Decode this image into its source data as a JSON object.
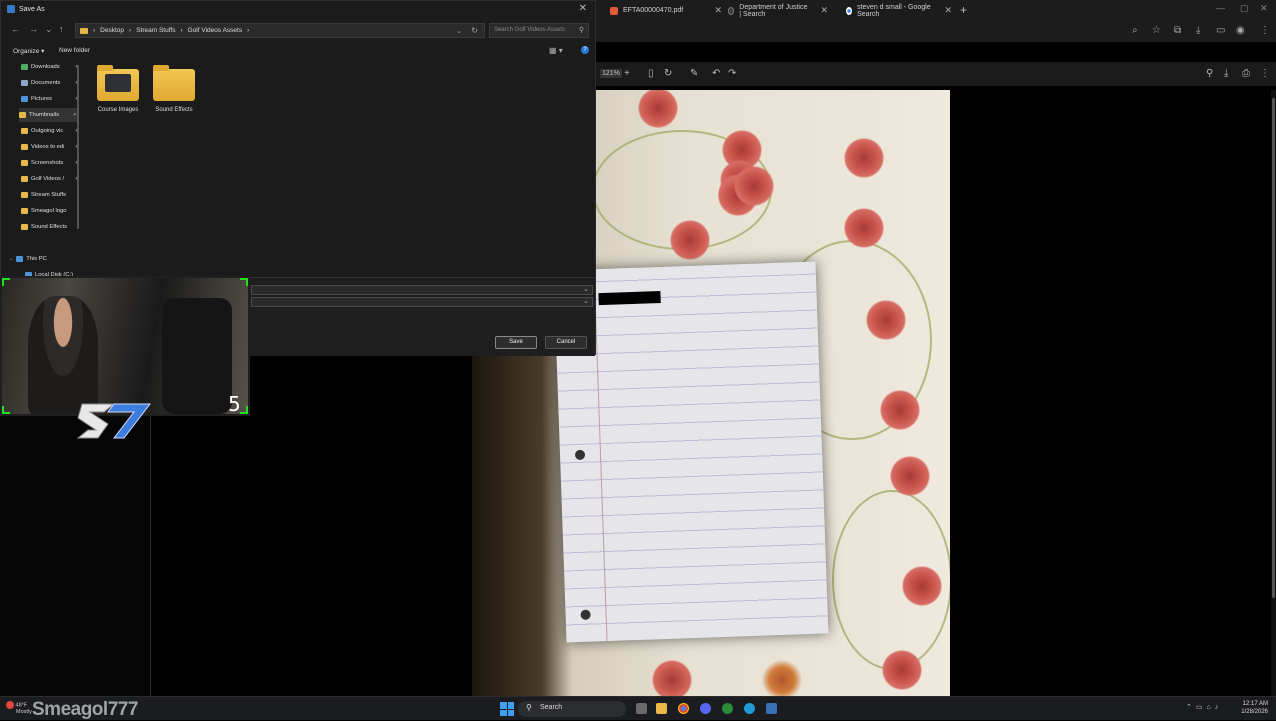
{
  "dialog": {
    "title": "Save As",
    "breadcrumb": [
      "Desktop",
      "Stream Stuffs",
      "Golf Videos Assets"
    ],
    "search_placeholder": "Search Golf Videos Assets",
    "organize_label": "Organize",
    "new_folder_label": "New folder",
    "nav_items": [
      {
        "label": "Downloads",
        "icon": "download-folder-icon",
        "pinned": true
      },
      {
        "label": "Documents",
        "icon": "documents-folder-icon",
        "pinned": true
      },
      {
        "label": "Pictures",
        "icon": "pictures-folder-icon",
        "pinned": true
      },
      {
        "label": "Thumbnails",
        "icon": "folder-icon",
        "pinned": true
      },
      {
        "label": "Outgoing vic",
        "icon": "folder-icon",
        "pinned": true
      },
      {
        "label": "Videos to edi",
        "icon": "folder-icon",
        "pinned": true
      },
      {
        "label": "Screenshots",
        "icon": "folder-icon",
        "pinned": true
      },
      {
        "label": "Golf Videos /",
        "icon": "folder-icon",
        "pinned": true
      },
      {
        "label": "Stream Stuffs",
        "icon": "folder-icon",
        "pinned": false
      },
      {
        "label": "Smeagol logo",
        "icon": "folder-icon",
        "pinned": false
      },
      {
        "label": "Sound Effects",
        "icon": "folder-icon",
        "pinned": false
      },
      {
        "label": "This PC",
        "icon": "computer-icon",
        "pinned": false
      },
      {
        "label": "Local Disk (C:)",
        "icon": "drive-icon",
        "pinned": false
      }
    ],
    "files": [
      {
        "label": "Course Images"
      },
      {
        "label": "Sound Effects"
      }
    ],
    "save_label": "Save",
    "cancel_label": "Cancel"
  },
  "browser": {
    "tabs": [
      {
        "label": "EFTA00000470.pdf",
        "icon": "pdf-icon"
      },
      {
        "label": "Department of Justice | Search",
        "icon": "doj-icon"
      },
      {
        "label": "steven d small - Google Search",
        "icon": "google-icon"
      }
    ],
    "new_tab": "+",
    "zoom": "121%"
  },
  "stream": {
    "counter": "5",
    "username": "Smeagol777"
  },
  "taskbar": {
    "search_label": "Search",
    "weather_temp": "48°F",
    "weather_desc": "Mostly",
    "time": "12:17 AM",
    "date": "1/28/2026"
  },
  "colors": {
    "accent": "#3b78c3",
    "folder": "#e8b84a",
    "webcam_frame": "#20e020"
  }
}
